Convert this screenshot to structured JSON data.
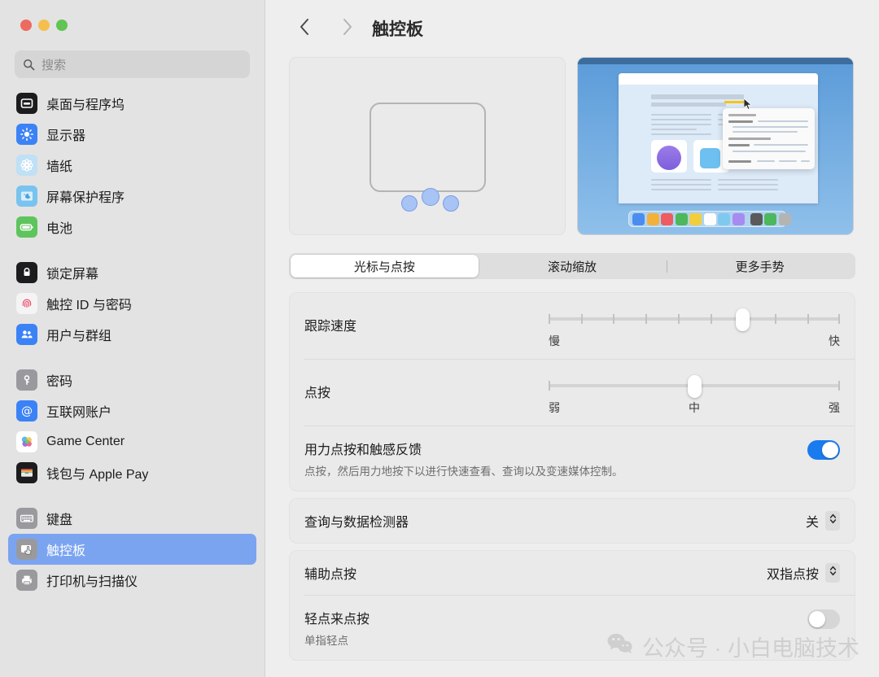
{
  "window": {
    "traffic_lights": [
      "close",
      "minimize",
      "maximize"
    ]
  },
  "sidebar": {
    "search": {
      "placeholder": "搜索",
      "value": "",
      "icon": "search-icon"
    },
    "groups": [
      {
        "items": [
          {
            "label": "桌面与程序坞",
            "icon": "desktop-dock-icon",
            "color": "#1c1c1e"
          },
          {
            "label": "显示器",
            "icon": "display-icon",
            "color": "#3b82f6"
          },
          {
            "label": "墙纸",
            "icon": "wallpaper-icon",
            "color": "#bfe0f5"
          },
          {
            "label": "屏幕保护程序",
            "icon": "screensaver-icon",
            "color": "#79c3ef"
          },
          {
            "label": "电池",
            "icon": "battery-icon",
            "color": "#5ec45d"
          }
        ]
      },
      {
        "items": [
          {
            "label": "锁定屏幕",
            "icon": "lock-screen-icon",
            "color": "#1c1c1e"
          },
          {
            "label": "触控 ID 与密码",
            "icon": "touch-id-icon",
            "color": "#f4f4f4"
          },
          {
            "label": "用户与群组",
            "icon": "users-groups-icon",
            "color": "#3b82f6"
          }
        ]
      },
      {
        "items": [
          {
            "label": "密码",
            "icon": "passwords-key-icon",
            "color": "#9a9a9e"
          },
          {
            "label": "互联网账户",
            "icon": "internet-accounts-icon",
            "color": "#3b82f6"
          },
          {
            "label": "Game Center",
            "icon": "game-center-icon",
            "color": "#ffffff"
          },
          {
            "label": "钱包与 Apple Pay",
            "icon": "wallet-applepay-icon",
            "color": "#1c1c1e"
          }
        ]
      },
      {
        "items": [
          {
            "label": "键盘",
            "icon": "keyboard-icon",
            "color": "#9a9a9e"
          },
          {
            "label": "触控板",
            "icon": "trackpad-icon",
            "color": "#9a9a9e",
            "selected": true
          },
          {
            "label": "打印机与扫描仪",
            "icon": "printer-scanner-icon",
            "color": "#9a9a9e"
          }
        ]
      }
    ],
    "selected_label": "触控板",
    "selection_color": "#7ba4f0"
  },
  "toolbar": {
    "back_icon": "chevron-left-icon",
    "forward_icon": "chevron-right-icon",
    "back_enabled": true,
    "forward_enabled": false,
    "title": "触控板"
  },
  "preview": {
    "left": {
      "name": "trackpad-gesture-preview",
      "fingers": 3
    },
    "right": {
      "name": "force-click-lookup-preview",
      "dock_colors": [
        "#4a8cf0",
        "#f2b13a",
        "#ee5b60",
        "#4db85b",
        "#f2cf3a",
        "#fdfdfd",
        "#7fc9ef",
        "#a78bf0",
        "#5a5a5a",
        "#4db85b",
        "#b4b4b4"
      ]
    }
  },
  "tabs": [
    {
      "label": "光标与点按",
      "active": true
    },
    {
      "label": "滚动缩放",
      "active": false
    },
    {
      "label": "更多手势",
      "active": false
    }
  ],
  "settings": {
    "tracking_speed": {
      "label": "跟踪速度",
      "min_label": "慢",
      "max_label": "快",
      "ticks": 10,
      "value_percent": 66
    },
    "click": {
      "label": "点按",
      "min_label": "弱",
      "mid_label": "中",
      "max_label": "强",
      "value_percent": 50
    },
    "force_click": {
      "title": "用力点按和触感反馈",
      "subtitle": "点按，然后用力地按下以进行快速查看、查询以及变速媒体控制。",
      "enabled": true
    },
    "lookup": {
      "label": "查询与数据检测器",
      "value": "关"
    },
    "secondary_click": {
      "label": "辅助点按",
      "value": "双指点按"
    },
    "tap_to_click": {
      "title": "轻点来点按",
      "subtitle": "单指轻点",
      "enabled": false
    }
  },
  "watermark": {
    "icon": "wechat-icon",
    "text": "公众号 · 小白电脑技术"
  }
}
